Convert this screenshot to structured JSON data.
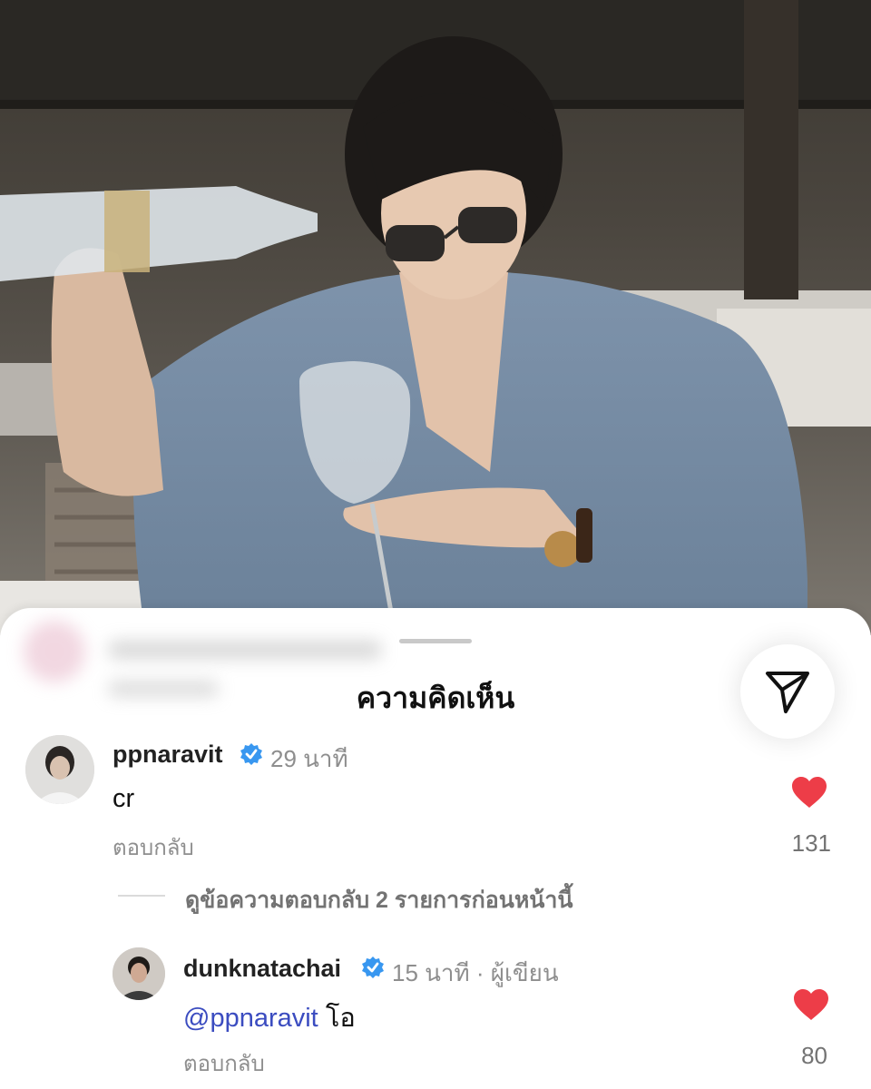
{
  "sheet": {
    "title": "ความคิดเห็น",
    "send_icon": "paper-plane-icon"
  },
  "comments": [
    {
      "username": "ppnaravit",
      "verified": true,
      "time": "29 นาที",
      "text": "cr",
      "reply_label": "ตอบกลับ",
      "likes": "131",
      "liked": true
    }
  ],
  "view_replies": "ดูข้อความตอบกลับ 2 รายการก่อนหน้านี้",
  "replies": [
    {
      "username": "dunknatachai",
      "verified": true,
      "time": "15 นาที · ผู้เขียน",
      "mention": "@ppnaravit",
      "text": "โอ",
      "reply_label": "ตอบกลับ",
      "likes": "80",
      "liked": true
    }
  ],
  "colors": {
    "heart": "#ed3d48",
    "verified": "#3897f0",
    "mention": "#3b4cc0"
  }
}
